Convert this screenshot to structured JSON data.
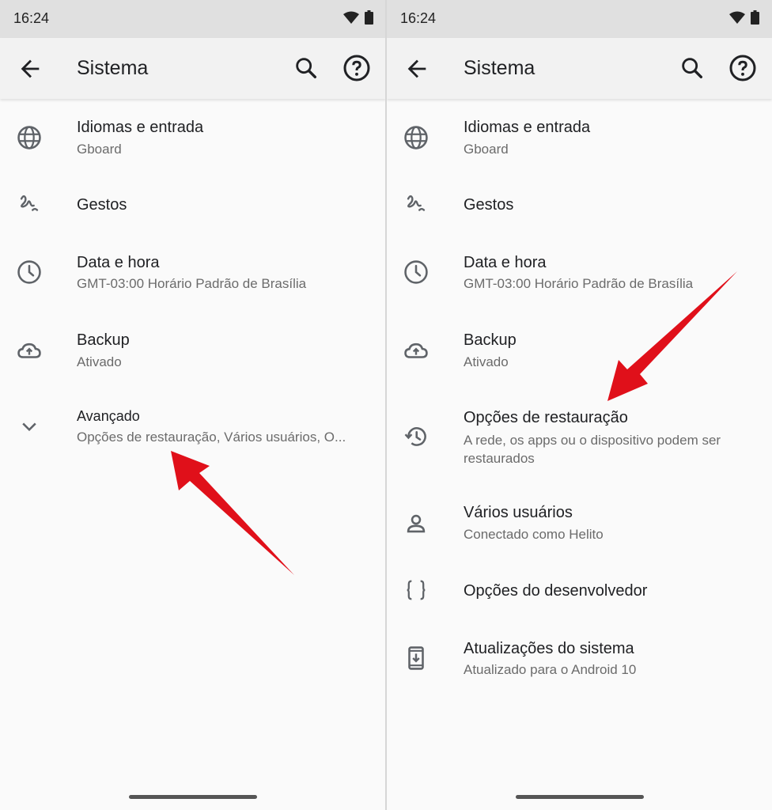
{
  "left": {
    "status": {
      "time": "16:24"
    },
    "appbar": {
      "title": "Sistema"
    },
    "items": [
      {
        "title": "Idiomas e entrada",
        "subtitle": "Gboard",
        "icon": "globe-icon"
      },
      {
        "title": "Gestos",
        "icon": "gesture-icon"
      },
      {
        "title": "Data e hora",
        "subtitle": "GMT-03:00 Horário Padrão de Brasília",
        "icon": "clock-icon"
      },
      {
        "title": "Backup",
        "subtitle": "Ativado",
        "icon": "cloud-upload-icon"
      },
      {
        "title": "Avançado",
        "subtitle": "Opções de restauração, Vários usuários, O...",
        "icon": "chevron-down-icon"
      }
    ]
  },
  "right": {
    "status": {
      "time": "16:24"
    },
    "appbar": {
      "title": "Sistema"
    },
    "items": [
      {
        "title": "Idiomas e entrada",
        "subtitle": "Gboard",
        "icon": "globe-icon"
      },
      {
        "title": "Gestos",
        "icon": "gesture-icon"
      },
      {
        "title": "Data e hora",
        "subtitle": "GMT-03:00 Horário Padrão de Brasília",
        "icon": "clock-icon"
      },
      {
        "title": "Backup",
        "subtitle": "Ativado",
        "icon": "cloud-upload-icon"
      },
      {
        "title": "Opções de restauração",
        "subtitle": "A rede, os apps ou o dispositivo podem ser restaurados",
        "icon": "restore-icon"
      },
      {
        "title": "Vários usuários",
        "subtitle": "Conectado como Helito",
        "icon": "person-icon"
      },
      {
        "title": "Opções do desenvolvedor",
        "icon": "braces-icon"
      },
      {
        "title": "Atualizações do sistema",
        "subtitle": "Atualizado para o Android 10",
        "icon": "system-update-icon"
      }
    ]
  },
  "colors": {
    "annotation_arrow": "#e0101a",
    "background": "#fafafa",
    "appbar": "#f2f2f2",
    "statusbar": "#e0e0e0"
  }
}
